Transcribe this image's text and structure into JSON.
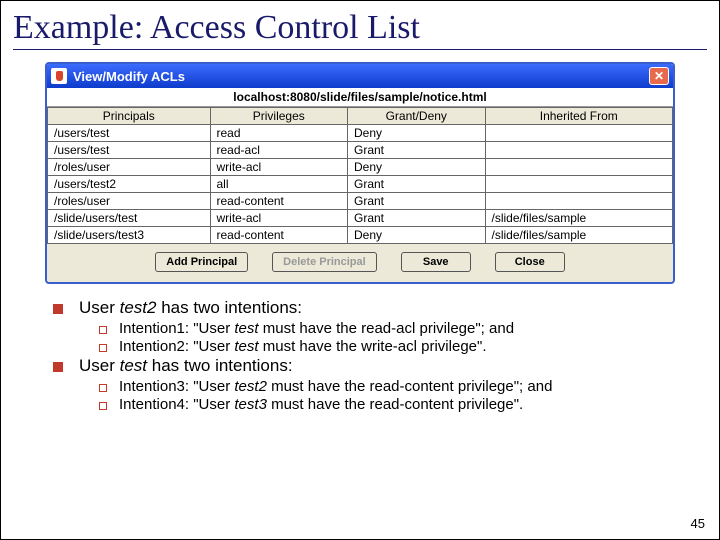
{
  "title": "Example: Access Control List",
  "acl_window": {
    "titlebar": "View/Modify ACLs",
    "close_glyph": "✕",
    "path": "localhost:8080/slide/files/sample/notice.html",
    "columns": [
      "Principals",
      "Privileges",
      "Grant/Deny",
      "Inherited From"
    ],
    "rows": [
      {
        "principal": "/users/test",
        "priv": "read",
        "gd": "Deny",
        "inh": ""
      },
      {
        "principal": "/users/test",
        "priv": "read-acl",
        "gd": "Grant",
        "inh": ""
      },
      {
        "principal": "/roles/user",
        "priv": "write-acl",
        "gd": "Deny",
        "inh": ""
      },
      {
        "principal": "/users/test2",
        "priv": "all",
        "gd": "Grant",
        "inh": ""
      },
      {
        "principal": "/roles/user",
        "priv": "read-content",
        "gd": "Grant",
        "inh": ""
      },
      {
        "principal": "/slide/users/test",
        "priv": "write-acl",
        "gd": "Grant",
        "inh": "/slide/files/sample"
      },
      {
        "principal": "/slide/users/test3",
        "priv": "read-content",
        "gd": "Deny",
        "inh": "/slide/files/sample"
      }
    ],
    "buttons": {
      "add": "Add Principal",
      "delete": "Delete Principal",
      "save": "Save",
      "close": "Close"
    }
  },
  "bullets": {
    "l1a_pre": "User ",
    "l1a_em": "test2",
    "l1a_post": " has two intentions:",
    "l2a_pre": "Intention1: \"User ",
    "l2a_em": "test",
    "l2a_post": " must have the read-acl privilege\"; and",
    "l2b_pre": "Intention2: \"User ",
    "l2b_em": "test",
    "l2b_post": " must have the write-acl privilege\".",
    "l1b_pre": "User ",
    "l1b_em": "test",
    "l1b_post": " has two intentions:",
    "l2c_pre": "Intention3: \"User ",
    "l2c_em": "test2",
    "l2c_post": " must have the read-content privilege\"; and",
    "l2d_pre": "Intention4: \"User ",
    "l2d_em": "test3",
    "l2d_post": " must have the read-content privilege\"."
  },
  "page_number": "45"
}
